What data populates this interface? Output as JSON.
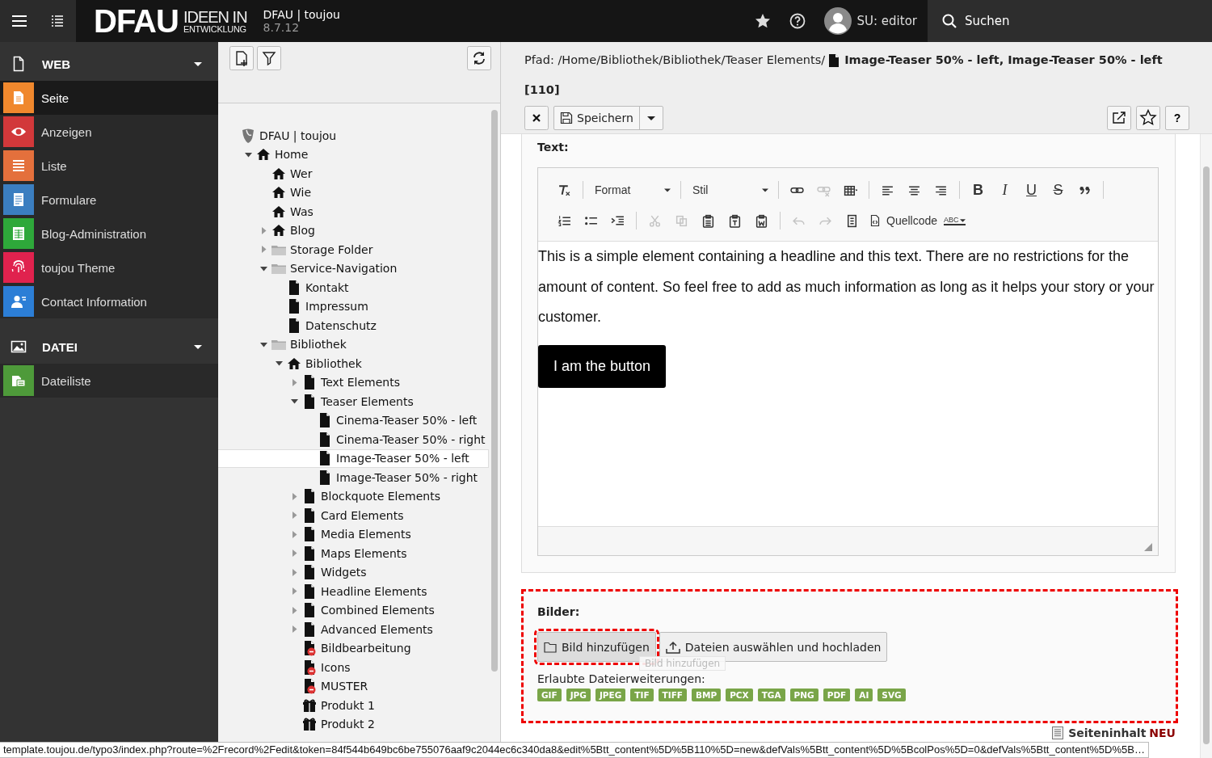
{
  "topbar": {
    "logo": {
      "wordmark": "DFAU",
      "line1": "IDEEN IN",
      "line2": "ENTWICKLUNG"
    },
    "site": "DFAU | toujou",
    "version": "8.7.12",
    "user": "SU: editor",
    "search": "Suchen"
  },
  "modules": [
    {
      "group": "WEB",
      "expanded": true,
      "items": [
        {
          "label": "Seite",
          "color": "#f0882d",
          "selected": true
        },
        {
          "label": "Anzeigen",
          "color": "#d2383a",
          "selected": false
        },
        {
          "label": "Liste",
          "color": "#e4703c",
          "selected": false
        },
        {
          "label": "Formulare",
          "color": "#3b7ec0",
          "selected": false
        },
        {
          "label": "Blog-Administration",
          "color": "#2ea83a",
          "selected": false
        },
        {
          "label": "toujou Theme",
          "color": "#e0224e",
          "selected": false
        },
        {
          "label": "Contact Information",
          "color": "#2c7ed6",
          "selected": false
        }
      ]
    },
    {
      "group": "DATEI",
      "expanded": true,
      "items": [
        {
          "label": "Dateiliste",
          "color": "#4e9a3a",
          "selected": false
        }
      ]
    }
  ],
  "page_tree": {
    "nodes": [
      {
        "label": "DFAU | toujou",
        "kind": "root",
        "selected": false,
        "children": [
          {
            "label": "Home",
            "kind": "home",
            "expanded": true,
            "selected": false,
            "children": [
              {
                "label": "Wer",
                "kind": "home",
                "selected": false
              },
              {
                "label": "Wie",
                "kind": "home",
                "selected": false
              },
              {
                "label": "Was",
                "kind": "home",
                "selected": false
              },
              {
                "label": "Blog",
                "kind": "home",
                "expanded": false,
                "selected": false
              },
              {
                "label": "Storage Folder",
                "kind": "folder",
                "expanded": false,
                "selected": false
              },
              {
                "label": "Service-Navigation",
                "kind": "folder",
                "expanded": true,
                "selected": false,
                "children": [
                  {
                    "label": "Kontakt",
                    "kind": "page",
                    "selected": false
                  },
                  {
                    "label": "Impressum",
                    "kind": "page",
                    "selected": false
                  },
                  {
                    "label": "Datenschutz",
                    "kind": "page",
                    "selected": false
                  }
                ]
              },
              {
                "label": "Bibliothek",
                "kind": "folder",
                "expanded": true,
                "selected": false,
                "children": [
                  {
                    "label": "Bibliothek",
                    "kind": "home",
                    "expanded": true,
                    "selected": false,
                    "children": [
                      {
                        "label": "Text Elements",
                        "kind": "page",
                        "expanded": false,
                        "selected": false
                      },
                      {
                        "label": "Teaser Elements",
                        "kind": "page",
                        "expanded": true,
                        "selected": false,
                        "children": [
                          {
                            "label": "Cinema-Teaser 50% - left",
                            "kind": "page",
                            "selected": false
                          },
                          {
                            "label": "Cinema-Teaser 50% - right",
                            "kind": "page",
                            "selected": false
                          },
                          {
                            "label": "Image-Teaser 50% - left",
                            "kind": "page",
                            "selected": true
                          },
                          {
                            "label": "Image-Teaser 50% - right",
                            "kind": "page",
                            "selected": false
                          }
                        ]
                      },
                      {
                        "label": "Blockquote Elements",
                        "kind": "page",
                        "expanded": false,
                        "selected": false
                      },
                      {
                        "label": "Card Elements",
                        "kind": "page",
                        "expanded": false,
                        "selected": false
                      },
                      {
                        "label": "Media Elements",
                        "kind": "page",
                        "expanded": false,
                        "selected": false
                      },
                      {
                        "label": "Maps Elements",
                        "kind": "page",
                        "expanded": false,
                        "selected": false
                      },
                      {
                        "label": "Widgets",
                        "kind": "page",
                        "expanded": false,
                        "selected": false
                      },
                      {
                        "label": "Headline Elements",
                        "kind": "page",
                        "expanded": false,
                        "selected": false
                      },
                      {
                        "label": "Combined Elements",
                        "kind": "page",
                        "expanded": false,
                        "selected": false
                      },
                      {
                        "label": "Advanced Elements",
                        "kind": "page",
                        "expanded": false,
                        "selected": false
                      },
                      {
                        "label": "Bildbearbeitung",
                        "kind": "hidden-page",
                        "selected": false
                      },
                      {
                        "label": "Icons",
                        "kind": "hidden-page",
                        "selected": false
                      },
                      {
                        "label": "MUSTER",
                        "kind": "hidden-page",
                        "selected": false
                      },
                      {
                        "label": "Produkt 1",
                        "kind": "product",
                        "selected": false
                      },
                      {
                        "label": "Produkt 2",
                        "kind": "product",
                        "selected": false
                      }
                    ]
                  }
                ]
              }
            ]
          }
        ]
      }
    ]
  },
  "editor": {
    "path": "Pfad: /Home/Bibliothek/Bibliothek/Teaser Elements/",
    "title": "Image-Teaser 50% - left, Image-Teaser 50% - left",
    "record_id": "[110]",
    "save": "Speichern",
    "help": "?",
    "text_field": {
      "label": "Text:",
      "toolbar": [
        [
          {
            "kind": "icon",
            "disabled": false
          },
          {
            "kind": "separator"
          },
          {
            "kind": "dropdown",
            "label": "Format"
          },
          {
            "kind": "separator"
          },
          {
            "kind": "dropdown",
            "label": "Stil"
          },
          {
            "kind": "separator"
          },
          {
            "kind": "icon",
            "disabled": false
          },
          {
            "kind": "icon",
            "disabled": true
          },
          {
            "kind": "icon",
            "disabled": false
          },
          {
            "kind": "separator"
          },
          {
            "kind": "icon",
            "disabled": false
          },
          {
            "kind": "icon",
            "disabled": false
          },
          {
            "kind": "icon",
            "disabled": false
          },
          {
            "kind": "separator"
          },
          {
            "kind": "bold",
            "label": "B"
          },
          {
            "kind": "italic",
            "label": "I"
          },
          {
            "kind": "underline",
            "label": "U"
          },
          {
            "kind": "strike",
            "label": "S"
          },
          {
            "kind": "icon",
            "disabled": false
          },
          {
            "kind": "separator"
          }
        ],
        [
          {
            "kind": "icon",
            "disabled": false
          },
          {
            "kind": "icon",
            "disabled": false
          },
          {
            "kind": "icon",
            "disabled": false
          },
          {
            "kind": "separator"
          },
          {
            "kind": "icon",
            "disabled": true
          },
          {
            "kind": "icon",
            "disabled": true
          },
          {
            "kind": "icon",
            "disabled": false
          },
          {
            "kind": "icon",
            "disabled": false
          },
          {
            "kind": "icon",
            "disabled": false
          },
          {
            "kind": "separator"
          },
          {
            "kind": "icon",
            "disabled": true
          },
          {
            "kind": "icon",
            "disabled": true
          },
          {
            "kind": "icon",
            "disabled": false
          },
          {
            "kind": "source",
            "label": "Quellcode"
          },
          {
            "kind": "spell",
            "label": "ABC"
          }
        ]
      ],
      "paragraph": "This is a simple element containing a headline and this text. There are no restrictions for the amount of content. So feel free to add as much information as long as it helps your story or your customer.",
      "button": "I am the button"
    },
    "images_field": {
      "label": "Bilder:",
      "add_button": "Bild hinzufügen",
      "upload_button": "Dateien auswählen und hochladen",
      "tooltip": "Bild hinzufügen",
      "allowed_label": "Erlaubte Dateierweiterungen:",
      "extensions": [
        "GIF",
        "JPG",
        "JPEG",
        "TIF",
        "TIFF",
        "BMP",
        "PCX",
        "TGA",
        "PNG",
        "PDF",
        "AI",
        "SVG"
      ]
    },
    "footer": {
      "label": "Seiteninhalt",
      "badge": "NEU"
    }
  },
  "status_bar": {
    "url": "template.toujou.de/typo3/index.php?route=%2Frecord%2Fedit&token=84f544b649bc6be755076aaf9c2044ec6c340da8&edit%5Btt_content%5D%5B110%5D=new&defVals%5Btt_content%5D%5BcolPos%5D=0&defVals%5Btt_content%5D%5B…"
  }
}
